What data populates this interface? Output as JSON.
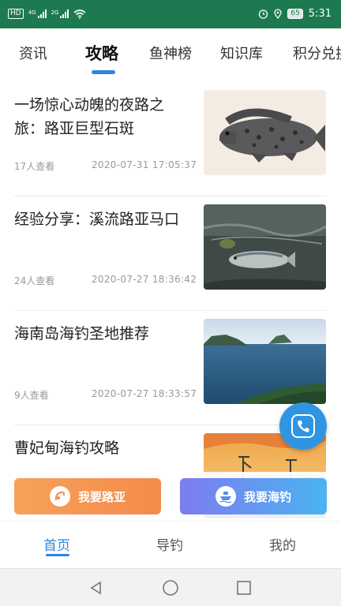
{
  "status_bar": {
    "hd_label": "HD",
    "sig1_label": "4G",
    "sig2_label": "2G",
    "battery": "65",
    "time": "5:31"
  },
  "tabs": [
    {
      "label": "资讯"
    },
    {
      "label": "攻略"
    },
    {
      "label": "鱼神榜"
    },
    {
      "label": "知识库"
    },
    {
      "label": "积分兑换"
    }
  ],
  "active_tab": "攻略",
  "articles": [
    {
      "title": "一场惊心动魄的夜路之旅：路亚巨型石斑",
      "views": "17人查看",
      "date": "2020-07-31 17:05:37",
      "image": "grouper-fish-photo"
    },
    {
      "title": "经验分享：溪流路亚马口",
      "views": "24人查看",
      "date": "2020-07-27 18:36:42",
      "image": "stream-fish-photo"
    },
    {
      "title": "海南岛海钓圣地推荐",
      "views": "9人查看",
      "date": "2020-07-27 18:33:57",
      "image": "island-sea-photo"
    },
    {
      "title": "曹妃甸海钓攻略",
      "views": "",
      "date": "",
      "image": "sunset-port-photo"
    }
  ],
  "fab": {
    "icon": "phone-icon"
  },
  "cta": {
    "lure_label": "我要路亚",
    "sea_label": "我要海钓"
  },
  "bottom_nav": [
    {
      "label": "首页"
    },
    {
      "label": "导钓"
    },
    {
      "label": "我的"
    }
  ],
  "colors": {
    "status_bar": "#1d7a50",
    "accent": "#2a86e0",
    "lure_gradient_start": "#f6a25a",
    "sea_gradient_end": "#4ab4f0"
  }
}
